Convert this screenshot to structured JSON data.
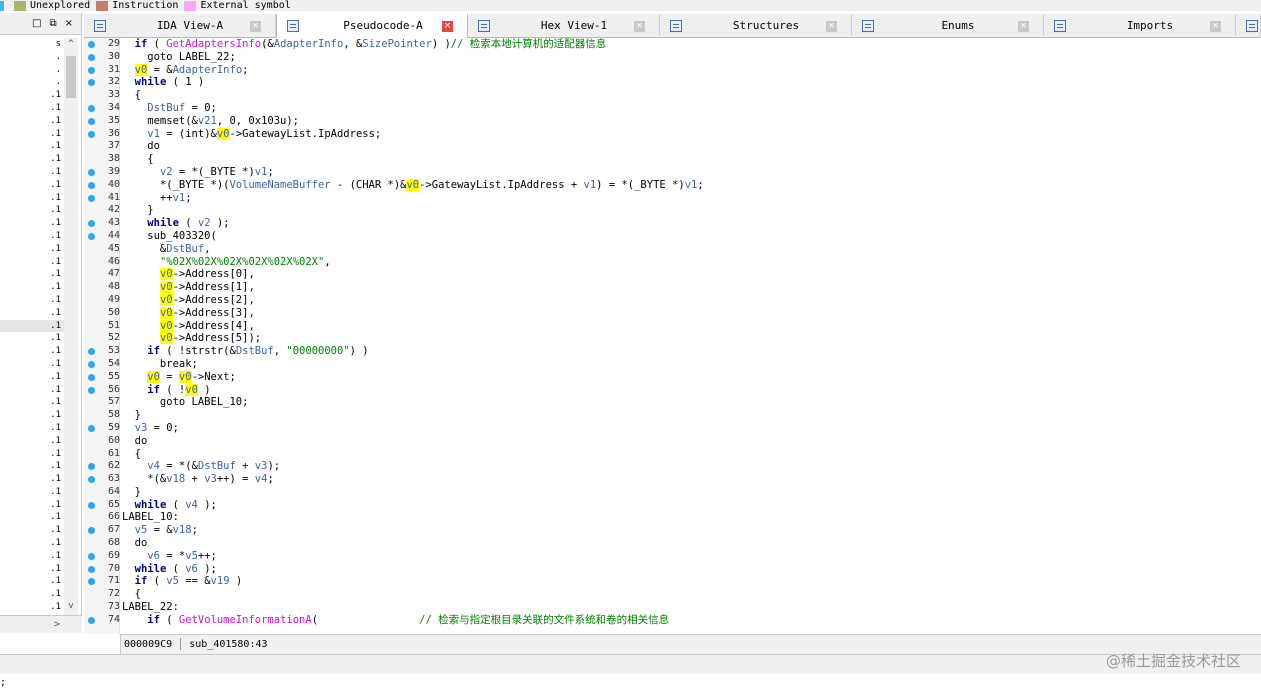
{
  "legend": [
    {
      "label": "Unexplored",
      "color": "#a9b56a"
    },
    {
      "label": "Instruction",
      "color": "#c0806a"
    },
    {
      "label": "External symbol",
      "color": "#f8a8f0"
    }
  ],
  "left_panel": {
    "controls": [
      "□",
      "⧉",
      "×"
    ],
    "rows": [
      "s",
      ".",
      ".",
      ".",
      ".1",
      ".1",
      ".1",
      ".1",
      ".1",
      ".1",
      ".1",
      ".1",
      ".1",
      ".1",
      ".1",
      ".1",
      ".1",
      ".1",
      ".1",
      ".1",
      ".1",
      ".1",
      ".1",
      ".1",
      ".1",
      ".1",
      ".1",
      ".1",
      ".1",
      ".1",
      ".1",
      ".1",
      ".1",
      ".1",
      ".1",
      ".1",
      ".1",
      ".1",
      ".1",
      ".1",
      ".1",
      ".1",
      ".1",
      ".1",
      ".1",
      ".1"
    ],
    "selected_index": 22,
    "scroll_up": "^",
    "scroll_down": "v",
    "hscroll_right": ">"
  },
  "tabs": [
    {
      "label": "IDA View-A",
      "active": false,
      "icon": "ida-view-icon"
    },
    {
      "label": "Pseudocode-A",
      "active": true,
      "icon": "pseudocode-icon"
    },
    {
      "label": "Hex View-1",
      "active": false,
      "icon": "hex-view-icon"
    },
    {
      "label": "Structures",
      "active": false,
      "icon": "structures-icon"
    },
    {
      "label": "Enums",
      "active": false,
      "icon": "enums-icon"
    },
    {
      "label": "Imports",
      "active": false,
      "icon": "imports-icon"
    }
  ],
  "code_lines": [
    {
      "n": "29",
      "dot": true,
      "html": "  <span class='kw'>if</span> ( <span class='fn'>GetAdaptersInfo</span>(&amp;<span class='var'>AdapterInfo</span>, &amp;<span class='var'>SizePointer</span>) )<span class='cmt'>// 检索本地计算机的适配器信息</span>"
    },
    {
      "n": "30",
      "dot": true,
      "html": "    goto LABEL_22;"
    },
    {
      "n": "31",
      "dot": true,
      "html": "  <span class='hl'>v0</span> = &amp;<span class='var'>AdapterInfo</span>;"
    },
    {
      "n": "32",
      "dot": true,
      "html": "  <span class='kw'>while</span> ( 1 )"
    },
    {
      "n": "33",
      "dot": false,
      "html": "  {"
    },
    {
      "n": "34",
      "dot": true,
      "html": "    <span class='var'>DstBuf</span> = 0;"
    },
    {
      "n": "35",
      "dot": true,
      "html": "    memset(&amp;<span class='var'>v21</span>, 0, 0x103u);"
    },
    {
      "n": "36",
      "dot": true,
      "html": "    <span class='var'>v1</span> = (int)&amp;<span class='hl'>v0</span>-&gt;GatewayList.IpAddress;"
    },
    {
      "n": "37",
      "dot": false,
      "html": "    do"
    },
    {
      "n": "38",
      "dot": false,
      "html": "    {"
    },
    {
      "n": "39",
      "dot": true,
      "html": "      <span class='var'>v2</span> = *(_BYTE *)<span class='var'>v1</span>;"
    },
    {
      "n": "40",
      "dot": true,
      "html": "      *(_BYTE *)(<span class='var'>VolumeNameBuffer</span> - (CHAR *)&amp;<span class='hl'>v0</span>-&gt;GatewayList.IpAddress + <span class='var'>v1</span>) = *(_BYTE *)<span class='var'>v1</span>;"
    },
    {
      "n": "41",
      "dot": true,
      "html": "      ++<span class='var'>v1</span>;"
    },
    {
      "n": "42",
      "dot": false,
      "html": "    }"
    },
    {
      "n": "43",
      "dot": true,
      "html": "    <span class='kw'>while</span> ( <span class='var'>v2</span> );"
    },
    {
      "n": "44",
      "dot": true,
      "html": "    sub_403320("
    },
    {
      "n": "45",
      "dot": false,
      "html": "      &amp;<span class='var'>DstBuf</span>,"
    },
    {
      "n": "46",
      "dot": false,
      "html": "      <span class='str'>\"%02X%02X%02X%02X%02X%02X\"</span>,"
    },
    {
      "n": "47",
      "dot": false,
      "html": "      <span class='hl'>v0</span>-&gt;Address[0],"
    },
    {
      "n": "48",
      "dot": false,
      "html": "      <span class='hl'>v0</span>-&gt;Address[1],"
    },
    {
      "n": "49",
      "dot": false,
      "html": "      <span class='hl'>v0</span>-&gt;Address[2],"
    },
    {
      "n": "50",
      "dot": false,
      "html": "      <span class='hl'>v0</span>-&gt;Address[3],"
    },
    {
      "n": "51",
      "dot": false,
      "html": "      <span class='hl'>v0</span>-&gt;Address[4],"
    },
    {
      "n": "52",
      "dot": false,
      "html": "      <span class='hl'>v0</span>-&gt;Address[5]);"
    },
    {
      "n": "53",
      "dot": true,
      "html": "    <span class='kw'>if</span> ( !strstr(&amp;<span class='var'>DstBuf</span>, <span class='str'>\"00000000\"</span>) )"
    },
    {
      "n": "54",
      "dot": true,
      "html": "      break;"
    },
    {
      "n": "55",
      "dot": true,
      "html": "    <span class='hl'>v0</span> = <span class='hl'>v0</span>-&gt;Next;"
    },
    {
      "n": "56",
      "dot": true,
      "html": "    <span class='kw'>if</span> ( !<span class='hl'>v0</span> )"
    },
    {
      "n": "57",
      "dot": false,
      "html": "      goto LABEL_10;"
    },
    {
      "n": "58",
      "dot": false,
      "html": "  }"
    },
    {
      "n": "59",
      "dot": true,
      "html": "  <span class='var'>v3</span> = 0;"
    },
    {
      "n": "60",
      "dot": false,
      "html": "  do"
    },
    {
      "n": "61",
      "dot": false,
      "html": "  {"
    },
    {
      "n": "62",
      "dot": true,
      "html": "    <span class='var'>v4</span> = *(&amp;<span class='var'>DstBuf</span> + <span class='var'>v3</span>);"
    },
    {
      "n": "63",
      "dot": true,
      "html": "    *(&amp;<span class='var'>v18</span> + <span class='var'>v3</span>++) = <span class='var'>v4</span>;"
    },
    {
      "n": "64",
      "dot": false,
      "html": "  }"
    },
    {
      "n": "65",
      "dot": true,
      "html": "  <span class='kw'>while</span> ( <span class='var'>v4</span> );"
    },
    {
      "n": "66",
      "dot": false,
      "html": "LABEL_10:"
    },
    {
      "n": "67",
      "dot": true,
      "html": "  <span class='var'>v5</span> = &amp;<span class='var'>v18</span>;"
    },
    {
      "n": "68",
      "dot": false,
      "html": "  do"
    },
    {
      "n": "69",
      "dot": true,
      "html": "    <span class='var'>v6</span> = *<span class='var'>v5</span>++;"
    },
    {
      "n": "70",
      "dot": true,
      "html": "  <span class='kw'>while</span> ( <span class='var'>v6</span> );"
    },
    {
      "n": "71",
      "dot": true,
      "html": "  <span class='kw'>if</span> ( <span class='var'>v5</span> == &amp;<span class='var'>v19</span> )"
    },
    {
      "n": "72",
      "dot": false,
      "html": "  {"
    },
    {
      "n": "73",
      "dot": false,
      "html": "LABEL_22:"
    },
    {
      "n": "74",
      "dot": true,
      "html": "    <span class='kw'>if</span> ( <span class='fn'>GetVolumeInformationA</span>(                <span class='cmt'>// 检索与指定根目录关联的文件系统和卷的相关信息</span>"
    }
  ],
  "status": {
    "address": "000009C9",
    "location": "sub_401580:43"
  },
  "bottom_text": ";",
  "watermark": "@稀土掘金技术社区"
}
